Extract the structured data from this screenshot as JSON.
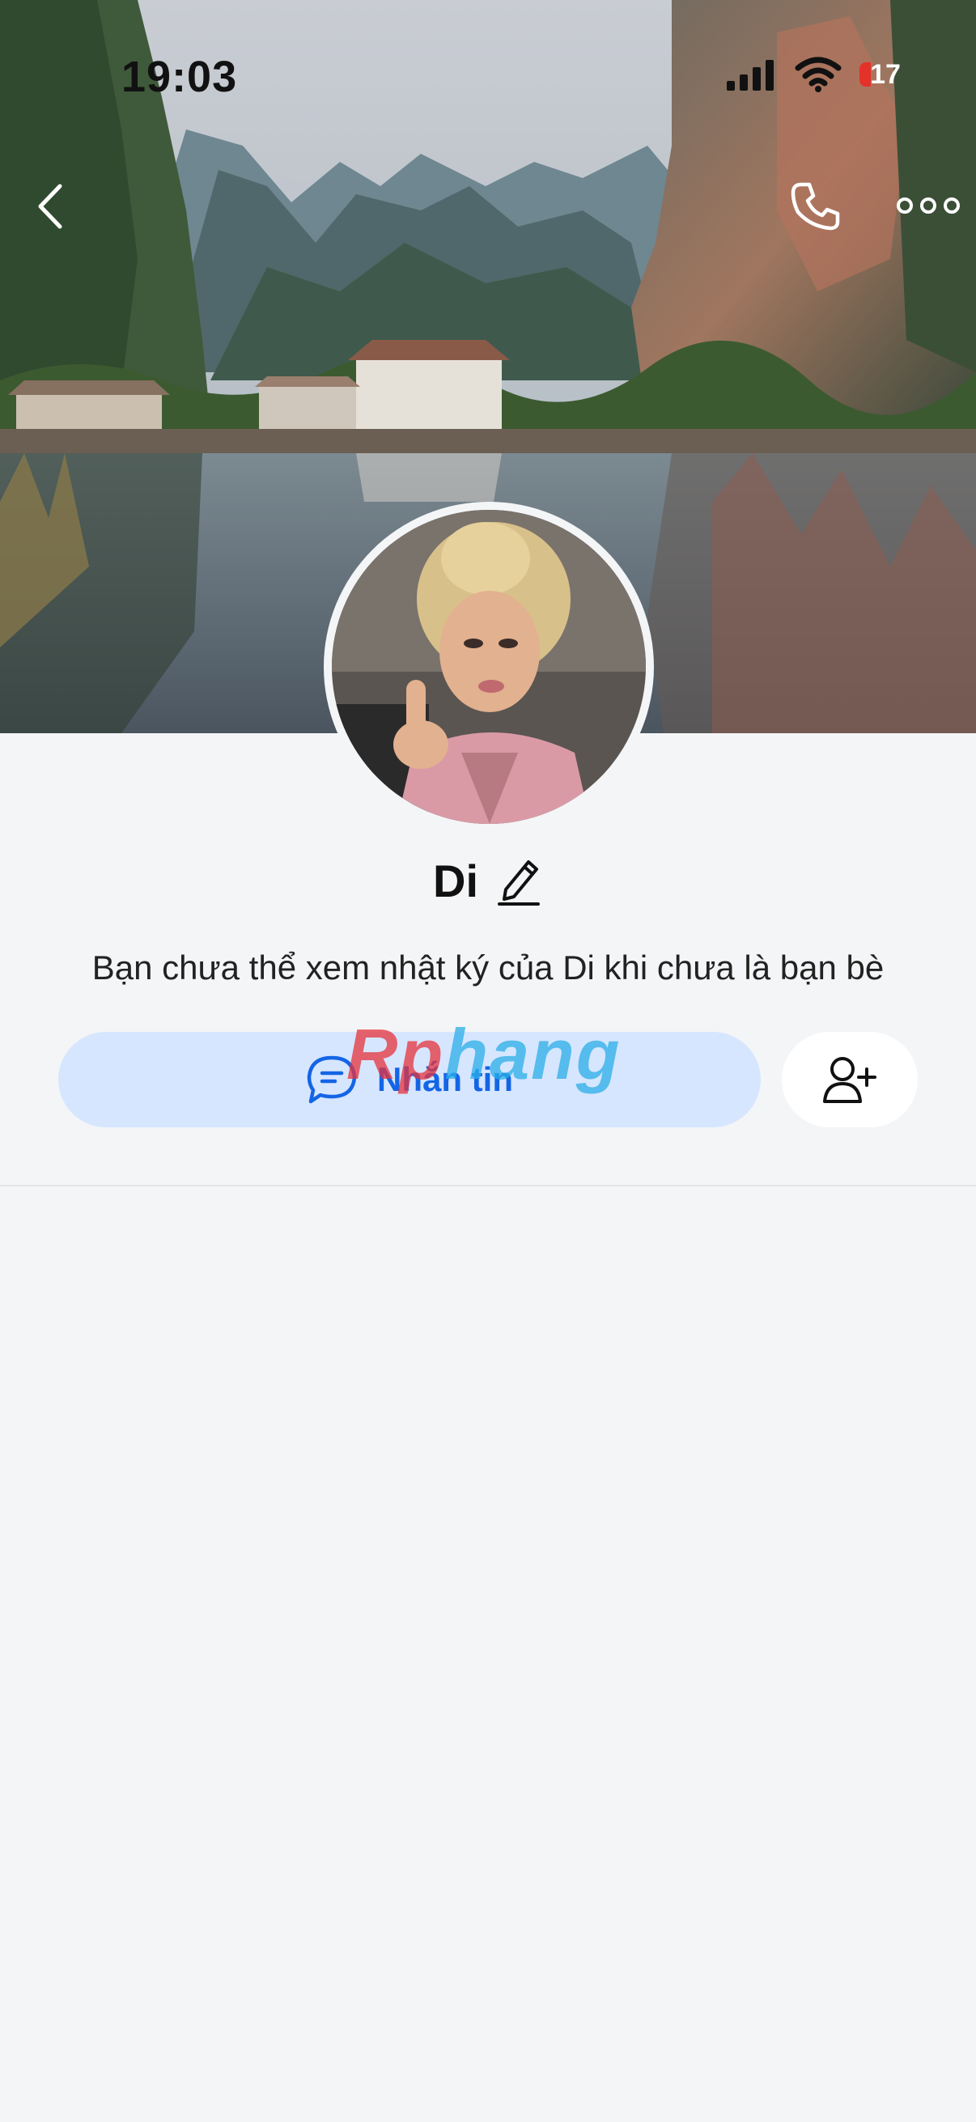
{
  "status_bar": {
    "time": "19:03",
    "battery_level": "17"
  },
  "nav": {
    "back_icon": "chevron-left-icon",
    "call_icon": "phone-icon",
    "more_icon": "more-dots-icon"
  },
  "profile": {
    "name": "Di",
    "privacy_note": "Bạn chưa thể xem nhật ký của Di khi chưa là bạn bè"
  },
  "actions": {
    "message_label": "Nhắn tin",
    "message_icon": "chat-bubble-icon",
    "add_friend_icon": "add-user-icon"
  },
  "watermark": {
    "part_a": "Rp",
    "part_b": "hang"
  },
  "colors": {
    "accent": "#1465e6",
    "button_bg": "#d6e6ff",
    "page_bg": "#f4f5f7",
    "battery_low": "#e4322b"
  }
}
